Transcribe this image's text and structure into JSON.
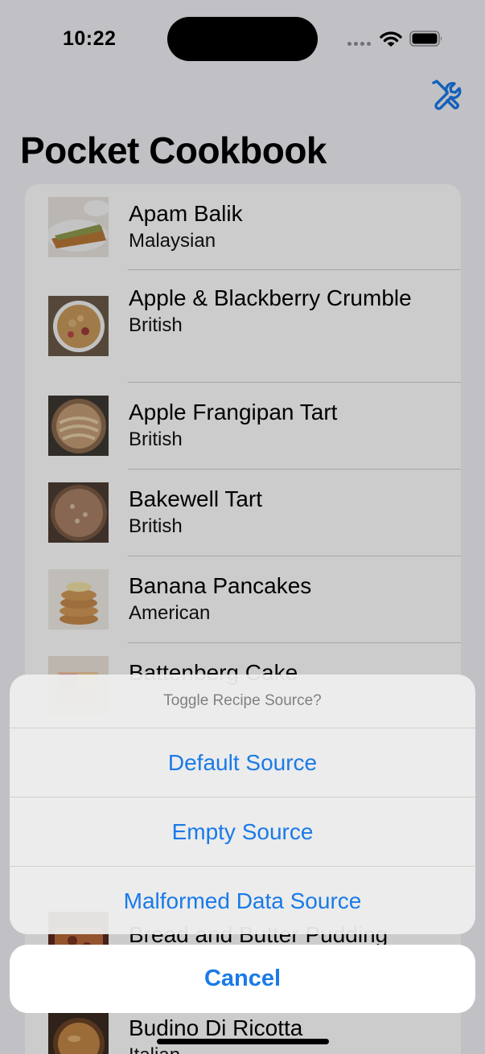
{
  "status_bar": {
    "time": "10:22"
  },
  "app": {
    "title": "Pocket Cookbook",
    "tools_icon": "wrench-screwdriver-icon"
  },
  "recipes": [
    {
      "name": "Apam Balik",
      "cuisine": "Malaysian"
    },
    {
      "name": "Apple & Blackberry Crumble",
      "cuisine": "British"
    },
    {
      "name": "Apple Frangipan Tart",
      "cuisine": "British"
    },
    {
      "name": "Bakewell Tart",
      "cuisine": "British"
    },
    {
      "name": "Banana Pancakes",
      "cuisine": "American"
    },
    {
      "name": "Battenberg Cake",
      "cuisine": ""
    },
    {
      "name": "Bread and Butter Pudding",
      "cuisine": ""
    },
    {
      "name": "Budino Di Ricotta",
      "cuisine": "Italian"
    }
  ],
  "action_sheet": {
    "title": "Toggle Recipe Source?",
    "options": [
      "Default Source",
      "Empty Source",
      "Malformed Data Source"
    ],
    "cancel": "Cancel"
  },
  "colors": {
    "accent": "#1a7ae8",
    "background": "#f2f2f7"
  }
}
